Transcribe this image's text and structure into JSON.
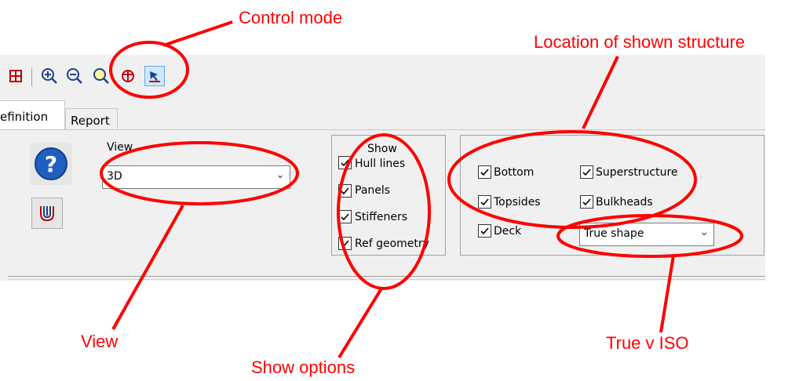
{
  "toolbar": {
    "icons": [
      "stop-icon",
      "zoom-in-icon",
      "zoom-out-icon",
      "zoom-fit-icon",
      "rotate-icon",
      "select-arrow-icon"
    ]
  },
  "tabs": [
    {
      "label": "efinition"
    },
    {
      "label": "Report"
    }
  ],
  "view": {
    "label": "View",
    "value": "3D"
  },
  "show": {
    "title": "Show",
    "items": [
      "Hull lines",
      "Panels",
      "Stiffeners",
      "Ref geometry"
    ]
  },
  "location": {
    "items": [
      "Bottom",
      "Superstructure",
      "Topsides",
      "Bulkheads",
      "Deck"
    ],
    "shape_value": "True shape"
  },
  "annotations": {
    "control_mode": "Control mode",
    "location": "Location of shown structure",
    "view": "View",
    "show_options": "Show options",
    "true_iso": "True v ISO"
  },
  "colors": {
    "annotation": "#ff0000",
    "panel": "#f0f0f0"
  }
}
